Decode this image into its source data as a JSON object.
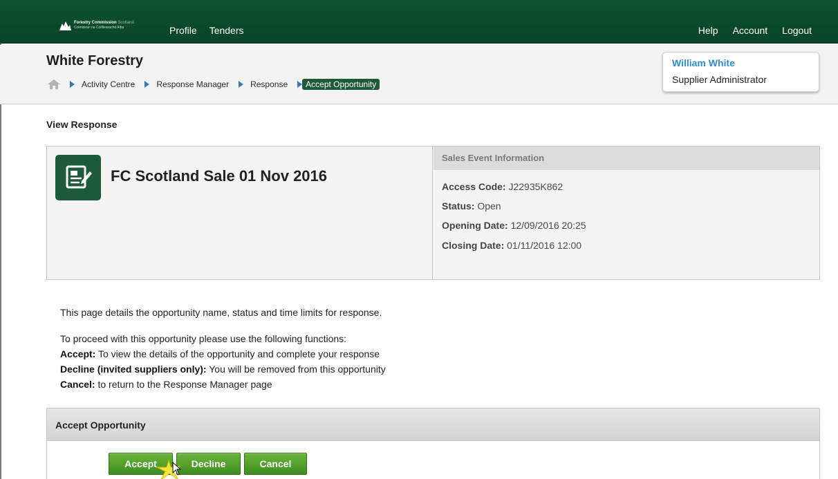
{
  "topnav": {
    "logo_line1": "Forestry Commission",
    "logo_line1_suffix": "Scotland",
    "logo_line2": "Coimisean na Coilltearachd Alba",
    "left_links": [
      "Profile",
      "Tenders"
    ],
    "right_links": [
      "Help",
      "Account",
      "Logout"
    ]
  },
  "header": {
    "org_title": "White Forestry",
    "breadcrumb": [
      "Activity Centre",
      "Response Manager",
      "Response"
    ],
    "breadcrumb_active": "Accept Opportunity"
  },
  "user": {
    "name": "William White",
    "role": "Supplier Administrator"
  },
  "section_title": "View Response",
  "opportunity": {
    "title": "FC Scotland Sale 01 Nov 2016"
  },
  "sales_info": {
    "heading": "Sales Event Information",
    "access_code_label": "Access Code:",
    "access_code": "J22935K862",
    "status_label": "Status:",
    "status": "Open",
    "opening_label": "Opening Date:",
    "opening_date": "12/09/2016 20:25",
    "closing_label": "Closing Date:",
    "closing_date": "01/11/2016 12:00"
  },
  "instructions": {
    "intro": "This page details the opportunity name, status and time limits for response.",
    "proceed": "To proceed with this opportunity please use the following functions:",
    "accept_label": "Accept:",
    "accept_text": "To view the details of the opportunity and complete your response",
    "decline_label": "Decline (invited suppliers only):",
    "decline_text": "You will be removed from this opportunity",
    "cancel_label": "Cancel:",
    "cancel_text": "to return to the Response Manager page"
  },
  "accept_section": {
    "heading": "Accept Opportunity",
    "buttons": [
      "Accept",
      "Decline",
      "Cancel"
    ]
  },
  "colors": {
    "brand_green": "#0d5130",
    "button_green": "#4c9e28",
    "link_blue": "#2f8ad4",
    "breadcrumb_arrow": "#3b78b8"
  }
}
